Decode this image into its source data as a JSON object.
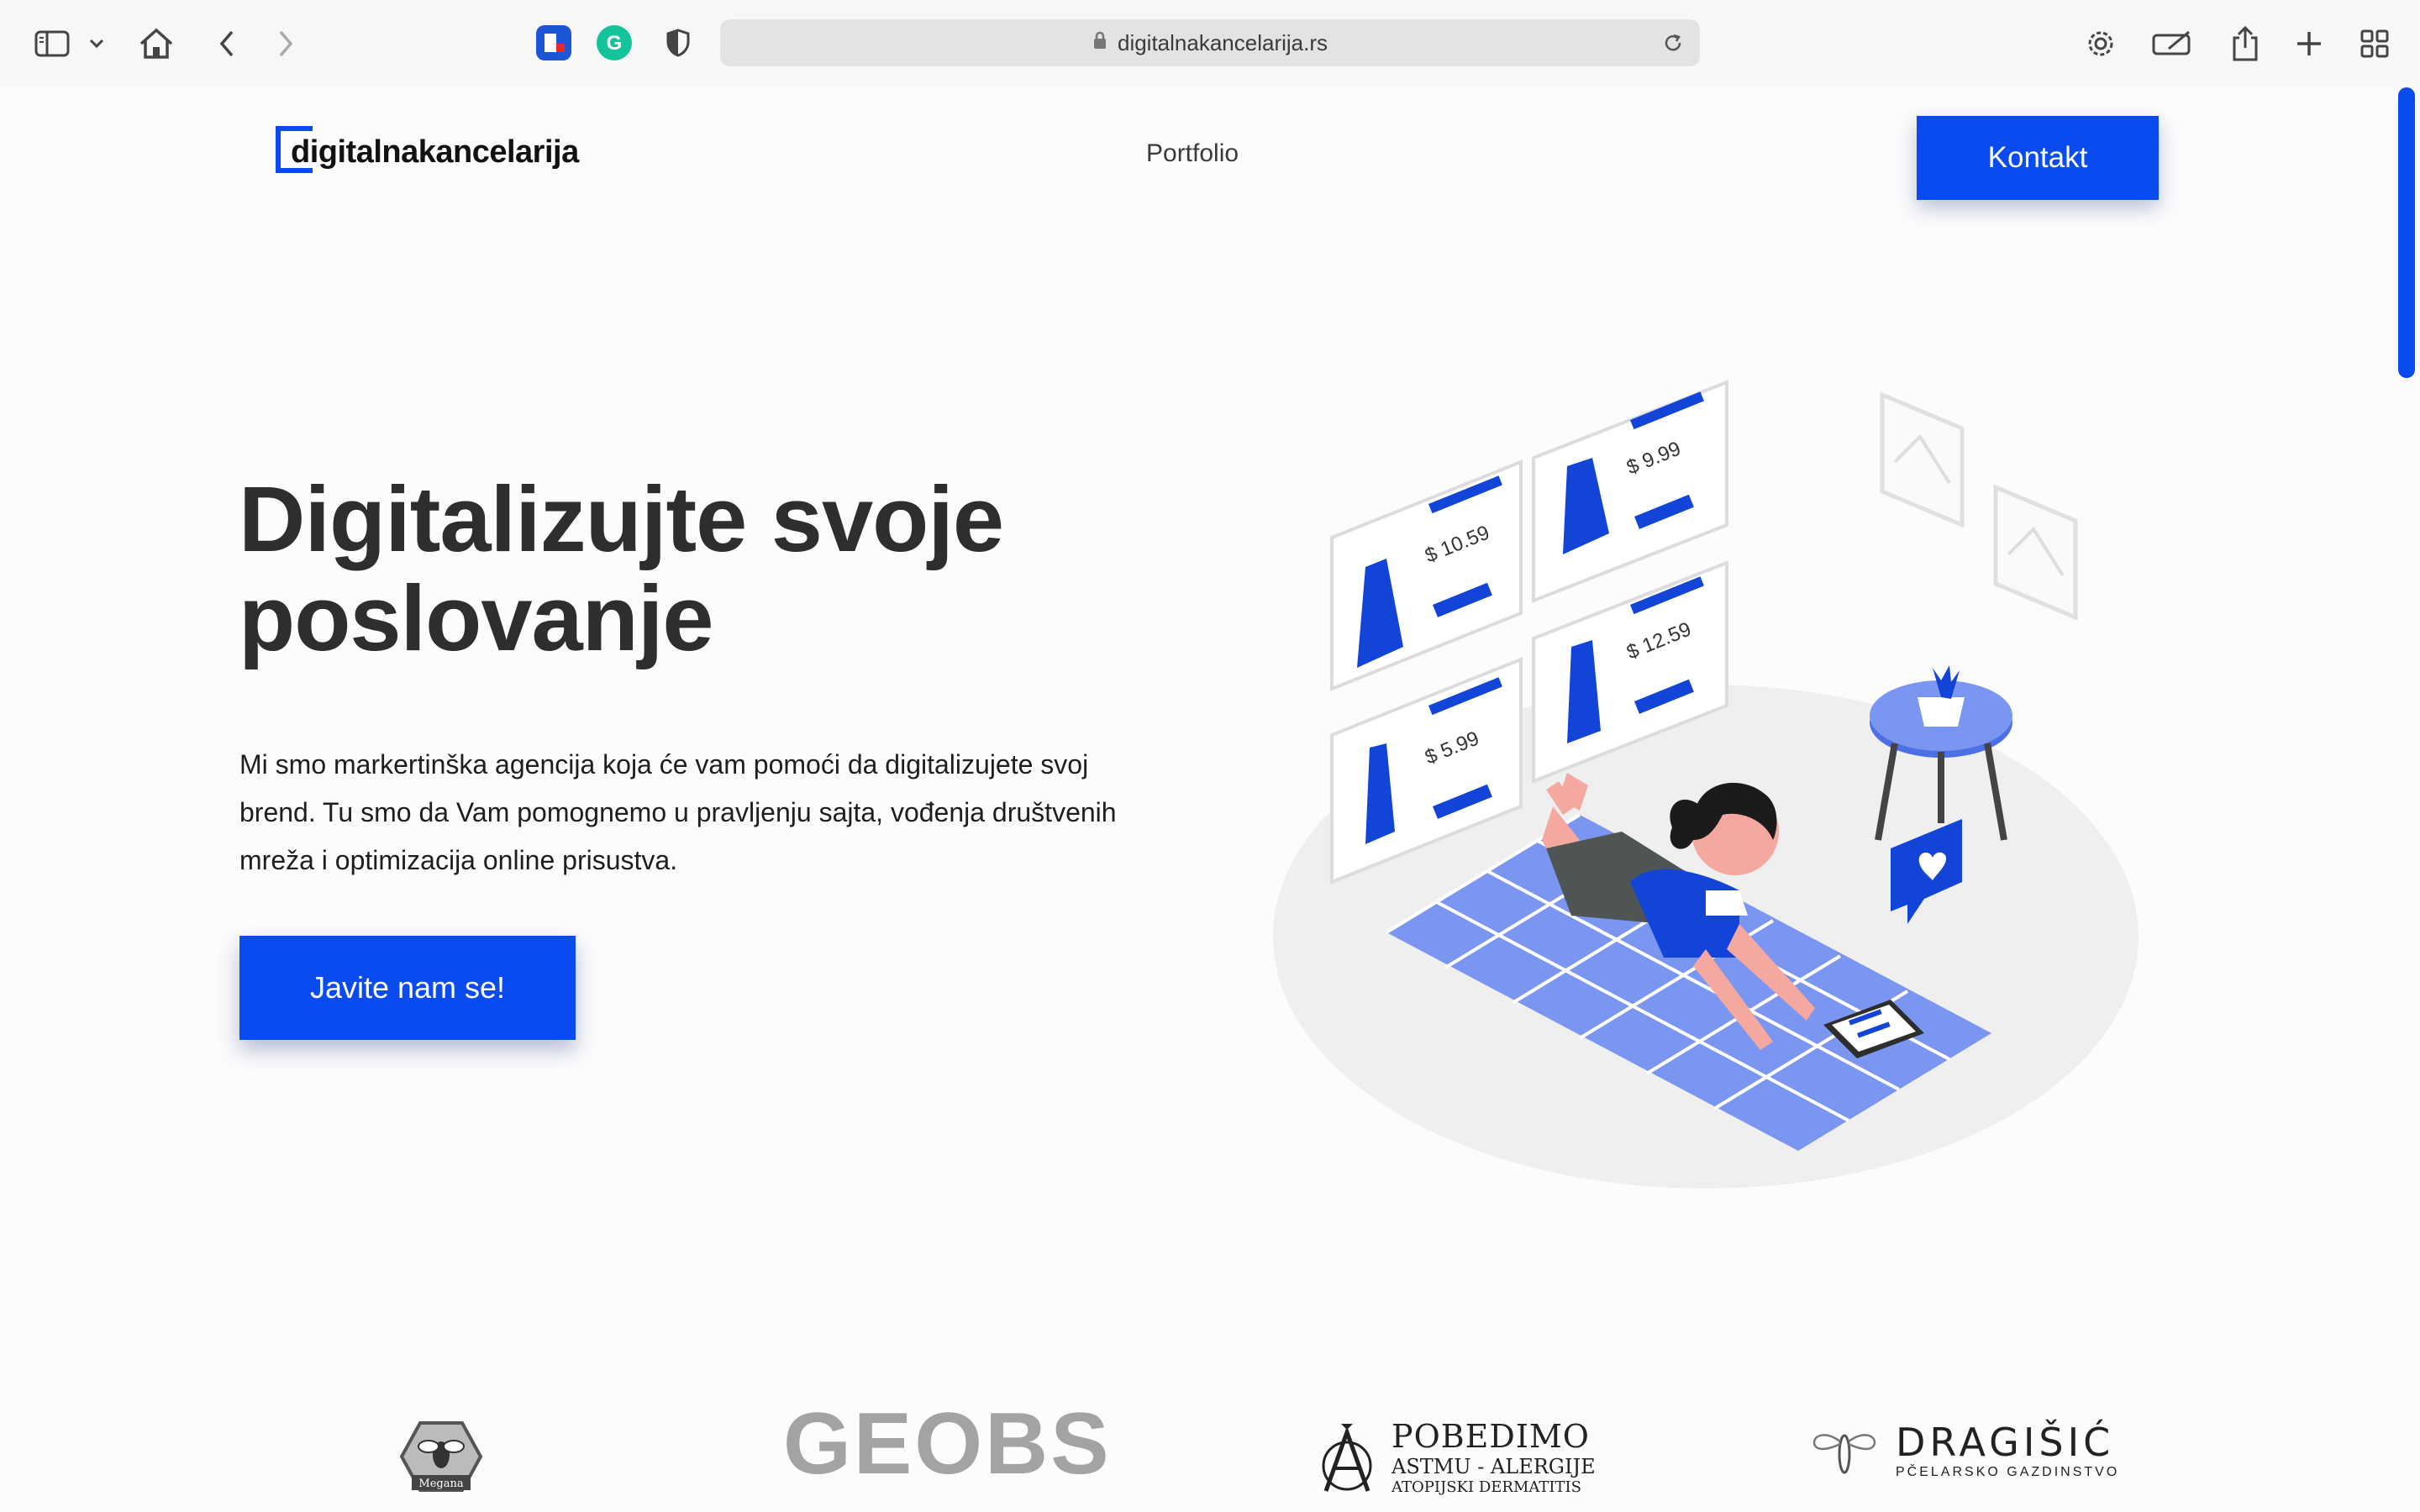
{
  "browser": {
    "url": "digitalnakancelarija.rs"
  },
  "nav": {
    "logo_text": "digitalnakancelarija",
    "portfolio": "Portfolio",
    "kontakt": "Kontakt"
  },
  "hero": {
    "title_line1": "Digitalizujte svoje",
    "title_line2": "poslovanje",
    "text": "Mi smo markertinška agencija koja će vam pomoći da digitalizujete svoj brend. Tu smo da Vam pomognemo u pravljenju sajta, vođenja društvenih mreža i optimizacija online prisustva.",
    "cta": "Javite nam se!"
  },
  "illustration": {
    "prices": [
      "$ 10.59",
      "$ 9.99",
      "$ 5.99",
      "$ 12.59"
    ]
  },
  "clients": {
    "megana": "Megana",
    "geobs": "GEOBS",
    "pobedimo": {
      "line1": "POBEDIMO",
      "line2": "ASTMU - ALERGIJE",
      "line3": "ATOPIJSKI DERMATITIS"
    },
    "dragisic": {
      "line1": "DRAGIŠIĆ",
      "line2": "PČELARSKO GAZDINSTVO"
    }
  },
  "colors": {
    "accent": "#0a4bf0",
    "heading": "#2e2e2e"
  }
}
